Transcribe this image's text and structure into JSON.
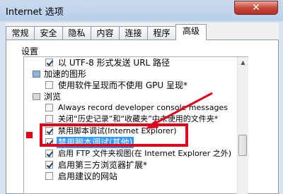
{
  "window": {
    "title": "Internet 选项",
    "close_glyph": "✕"
  },
  "tabs": [
    {
      "label": "常规",
      "active": false
    },
    {
      "label": "安全",
      "active": false
    },
    {
      "label": "隐私",
      "active": false
    },
    {
      "label": "内容",
      "active": false
    },
    {
      "label": "连接",
      "active": false
    },
    {
      "label": "程序",
      "active": false
    },
    {
      "label": "高级",
      "active": true
    }
  ],
  "settings": {
    "section_label": "设置",
    "rows": [
      {
        "type": "checkbox",
        "checked": true,
        "label": "以 UTF-8 形式发送 URL 路径"
      },
      {
        "type": "group",
        "icon": "graphics-group-icon",
        "label": "加速的图形"
      },
      {
        "type": "checkbox",
        "checked": false,
        "label": "使用软件呈现而不使用 GPU 呈现*"
      },
      {
        "type": "group",
        "icon": "browsing-group-icon",
        "label": "浏览"
      },
      {
        "type": "checkbox",
        "checked": false,
        "label": "Always record developer console messages"
      },
      {
        "type": "checkbox",
        "checked": false,
        "label": "关闭“历史记录”和“收藏夹”中未使用的文件夹*"
      },
      {
        "type": "checkbox",
        "checked": true,
        "label": "禁用脚本调试(Internet Explorer)"
      },
      {
        "type": "checkbox",
        "checked": true,
        "label": "禁用脚本调试(其他)",
        "selected": true
      },
      {
        "type": "checkbox",
        "checked": true,
        "label": "启用 FTP 文件夹视图(在 Internet Explorer 之外)"
      },
      {
        "type": "checkbox",
        "checked": true,
        "label": "启用第三方浏览器扩展*"
      },
      {
        "type": "checkbox",
        "checked": false,
        "label": "启用建议的网站"
      }
    ]
  },
  "annotation": {
    "color": "#e0001b"
  }
}
